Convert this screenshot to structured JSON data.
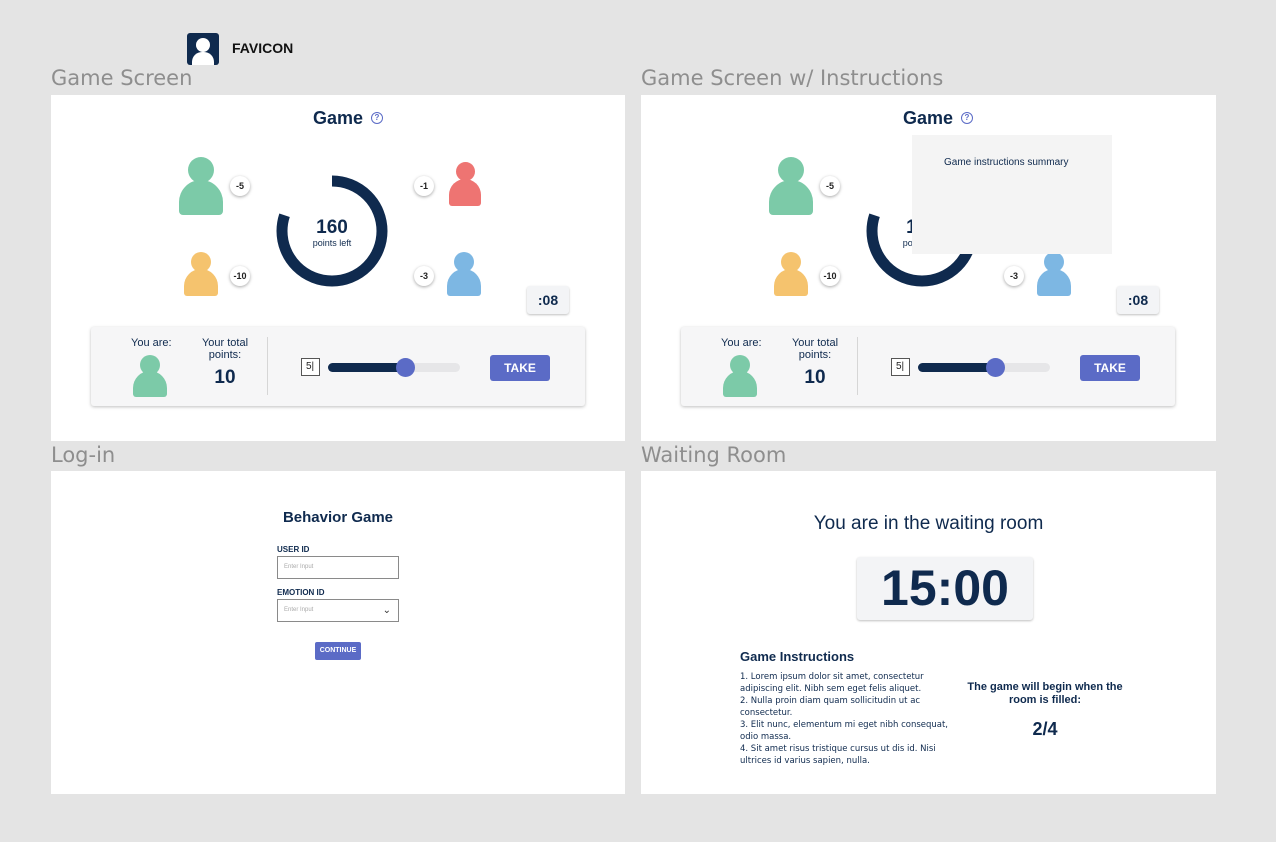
{
  "favicon": {
    "label": "FAVICON"
  },
  "labels": {
    "game_screen": "Game Screen",
    "game_screen_instructions": "Game Screen w/ Instructions",
    "login": "Log-in",
    "waiting_room": "Waiting Room"
  },
  "game": {
    "title": "Game",
    "help_icon": "?",
    "points_left_value": "160",
    "points_left_label": "points left",
    "points_left_fraction": 0.8,
    "players": {
      "green": {
        "color": "#7ccaa8",
        "badge": "-5"
      },
      "red": {
        "color": "#ee7472",
        "badge": "-1"
      },
      "yellow": {
        "color": "#f5c36e",
        "badge": "-10"
      },
      "blue": {
        "color": "#7db7e3",
        "badge": "-3"
      }
    },
    "timer": ":08",
    "you_are": "You are:",
    "total_points_label": "Your total points:",
    "total_points_value": "10",
    "slider_value": "5|",
    "slider_fraction": 0.58,
    "take_label": "TAKE",
    "colors": {
      "navy": "#0f2a4e",
      "accent": "#5b6bc6"
    }
  },
  "instructions_popup": {
    "text": "Game instructions summary"
  },
  "login": {
    "title": "Behavior Game",
    "user_id_label": "USER ID",
    "user_id_placeholder": "Enter Input",
    "emotion_id_label": "EMOTION ID",
    "emotion_id_placeholder": "Enter Input",
    "continue_label": "CONTINUE"
  },
  "waiting": {
    "title": "You are in the waiting room",
    "clock": "15:00",
    "instructions_title": "Game Instructions",
    "instructions": [
      "1. Lorem ipsum dolor sit amet, consectetur adipiscing elit. Nibh sem eget felis aliquet.",
      "2. Nulla proin diam quam sollicitudin ut ac consectetur.",
      "3. Elit nunc, elementum mi eget nibh consequat, odio massa.",
      "4. Sit amet risus tristique cursus ut dis id. Nisi ultrices id varius sapien, nulla."
    ],
    "begin_text": "The game will begin when the room is filled:",
    "room_count": "2/4"
  }
}
